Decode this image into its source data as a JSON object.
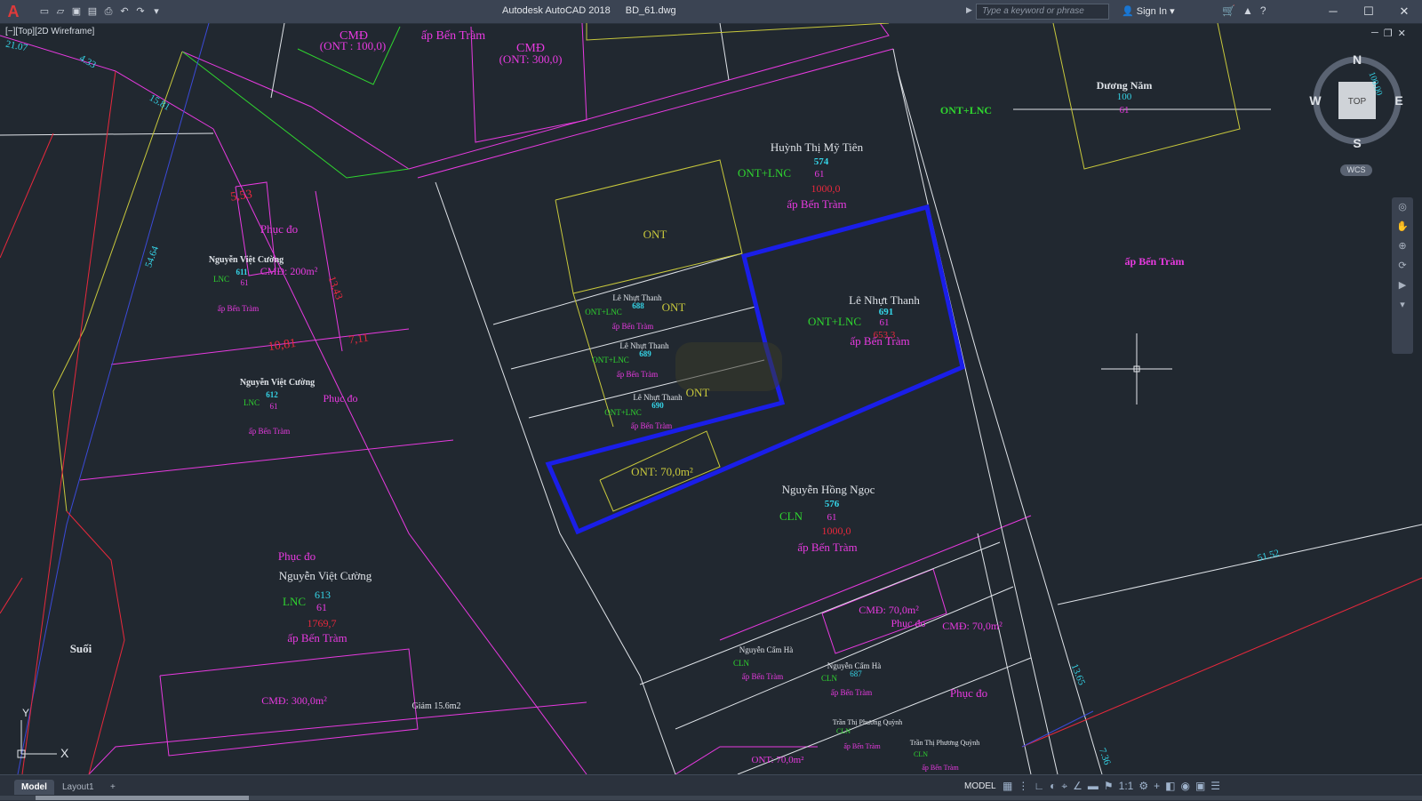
{
  "app": {
    "title": "Autodesk AutoCAD 2018",
    "file": "BD_61.dwg",
    "logo": "A",
    "search_placeholder": "Type a keyword or phrase",
    "sign_in": "Sign In"
  },
  "viewport": {
    "label": "[−][Top][2D Wireframe]"
  },
  "viewcube": {
    "north": "N",
    "south": "S",
    "east": "E",
    "west": "W",
    "face": "TOP",
    "wcs": "WCS"
  },
  "ucs": {
    "x": "X",
    "y": "Y"
  },
  "colors": {
    "background": "#212830",
    "highlight": "#1a1ee8",
    "magenta": "#e83ae0",
    "green": "#2fd62f",
    "yellow": "#c8c83c",
    "cyan": "#35d5e8",
    "red": "#e8283c",
    "white": "#dfe3e8"
  },
  "drawing": {
    "dims": [
      {
        "text": "21.07",
        "color": "cyan"
      },
      {
        "text": "4.33",
        "color": "cyan"
      },
      {
        "text": "15.81",
        "color": "cyan"
      },
      {
        "text": "54.64",
        "color": "cyan"
      },
      {
        "text": "13.65",
        "color": "cyan"
      },
      {
        "text": "7.36",
        "color": "cyan"
      },
      {
        "text": "51.52",
        "color": "cyan"
      },
      {
        "text": "100.00",
        "color": "cyan"
      },
      {
        "text": "5,53",
        "color": "red"
      },
      {
        "text": "13,43",
        "color": "red"
      },
      {
        "text": "10,81",
        "color": "red"
      },
      {
        "text": "7,11",
        "color": "red"
      }
    ],
    "labels": [
      {
        "text": "CMĐ",
        "color": "magenta"
      },
      {
        "text": "(ONT : 100,0)",
        "color": "magenta"
      },
      {
        "text": "ấp Bến Tràm",
        "color": "magenta"
      },
      {
        "text": "CMĐ",
        "color": "magenta"
      },
      {
        "text": "(ONT: 300,0)",
        "color": "magenta"
      },
      {
        "text": "Dương Năm",
        "color": "white"
      },
      {
        "text": "100",
        "color": "cyan"
      },
      {
        "text": "61",
        "color": "magenta"
      },
      {
        "text": "ONT+LNC",
        "color": "green"
      },
      {
        "text": "ấp Bến Tràm",
        "color": "magenta"
      },
      {
        "text": "Huỳnh Thị Mỹ Tiên",
        "color": "white"
      },
      {
        "text": "574",
        "color": "cyan"
      },
      {
        "text": "ONT+LNC",
        "color": "green"
      },
      {
        "text": "61",
        "color": "magenta"
      },
      {
        "text": "1000,0",
        "color": "red"
      },
      {
        "text": "ấp Bến Tràm",
        "color": "magenta"
      },
      {
        "text": "ONT",
        "color": "yellow"
      },
      {
        "text": "Lê Nhựt Thanh",
        "color": "white"
      },
      {
        "text": "688",
        "color": "cyan"
      },
      {
        "text": "ONT+LNC",
        "color": "green"
      },
      {
        "text": "ấp Bến Tràm",
        "color": "magenta"
      },
      {
        "text": "ONT",
        "color": "yellow"
      },
      {
        "text": "Lê Nhựt Thanh",
        "color": "white"
      },
      {
        "text": "689",
        "color": "cyan"
      },
      {
        "text": "ONT+LNC",
        "color": "green"
      },
      {
        "text": "ấp Bến Tràm",
        "color": "magenta"
      },
      {
        "text": "Lê Nhựt Thanh",
        "color": "white"
      },
      {
        "text": "690",
        "color": "cyan"
      },
      {
        "text": "ONT+LNC",
        "color": "green"
      },
      {
        "text": "ấp Bến Tràm",
        "color": "magenta"
      },
      {
        "text": "ONT",
        "color": "yellow"
      },
      {
        "text": "Lê Nhựt Thanh",
        "color": "white"
      },
      {
        "text": "691",
        "color": "cyan"
      },
      {
        "text": "ONT+LNC",
        "color": "green"
      },
      {
        "text": "61",
        "color": "magenta"
      },
      {
        "text": "653,3",
        "color": "red"
      },
      {
        "text": "ấp Bến Tràm",
        "color": "magenta"
      },
      {
        "text": "ONT: 70,0m²",
        "color": "yellow"
      },
      {
        "text": "Nguyễn Hồng Ngọc",
        "color": "white"
      },
      {
        "text": "576",
        "color": "cyan"
      },
      {
        "text": "CLN",
        "color": "green"
      },
      {
        "text": "61",
        "color": "magenta"
      },
      {
        "text": "1000,0",
        "color": "red"
      },
      {
        "text": "ấp Bến Tràm",
        "color": "magenta"
      },
      {
        "text": "Phục đo",
        "color": "magenta"
      },
      {
        "text": "Nguyễn Việt Cường",
        "color": "white"
      },
      {
        "text": "611",
        "color": "cyan"
      },
      {
        "text": "LNC",
        "color": "green"
      },
      {
        "text": "CMĐ: 200m²",
        "color": "magenta"
      },
      {
        "text": "61",
        "color": "magenta"
      },
      {
        "text": "ấp Bến Tràm",
        "color": "magenta"
      },
      {
        "text": "Nguyễn Việt Cường",
        "color": "white"
      },
      {
        "text": "612",
        "color": "cyan"
      },
      {
        "text": "LNC",
        "color": "green"
      },
      {
        "text": "61",
        "color": "magenta"
      },
      {
        "text": "Phục đo",
        "color": "magenta"
      },
      {
        "text": "ấp Bến Tràm",
        "color": "magenta"
      },
      {
        "text": "Phục đo",
        "color": "magenta"
      },
      {
        "text": "Nguyễn Việt Cường",
        "color": "white"
      },
      {
        "text": "LNC",
        "color": "green"
      },
      {
        "text": "613",
        "color": "cyan"
      },
      {
        "text": "61",
        "color": "magenta"
      },
      {
        "text": "1769,7",
        "color": "red"
      },
      {
        "text": "ấp Bến Tràm",
        "color": "magenta"
      },
      {
        "text": "Suối",
        "color": "white"
      },
      {
        "text": "CMĐ: 300,0m²",
        "color": "magenta"
      },
      {
        "text": "Giảm 15.6m2",
        "color": "white"
      },
      {
        "text": "CMĐ: 70,0m²",
        "color": "magenta"
      },
      {
        "text": "Phục đo",
        "color": "magenta"
      },
      {
        "text": "CMĐ: 70,0m²",
        "color": "magenta"
      },
      {
        "text": "Nguyễn Cẩm Hà",
        "color": "white"
      },
      {
        "text": "CLN",
        "color": "green"
      },
      {
        "text": "ấp Bến Tràm",
        "color": "magenta"
      },
      {
        "text": "Nguyễn Cẩm Hà",
        "color": "white"
      },
      {
        "text": "687",
        "color": "cyan"
      },
      {
        "text": "CLN",
        "color": "green"
      },
      {
        "text": "ấp Bến Tràm",
        "color": "magenta"
      },
      {
        "text": "Phục đo",
        "color": "magenta"
      },
      {
        "text": "Trần Thị Phương Quỳnh",
        "color": "white"
      },
      {
        "text": "CLN",
        "color": "green"
      },
      {
        "text": "ấp Bến Tràm",
        "color": "magenta"
      },
      {
        "text": "Trần Thị Phương Quỳnh",
        "color": "white"
      },
      {
        "text": "CLN",
        "color": "green"
      },
      {
        "text": "ấp Bến Tràm",
        "color": "magenta"
      },
      {
        "text": "ONT: 70,0m²",
        "color": "magenta"
      }
    ]
  },
  "statusbar": {
    "tabs": [
      "Model",
      "Layout1",
      "+"
    ],
    "space": "MODEL",
    "scale": "1:1"
  }
}
